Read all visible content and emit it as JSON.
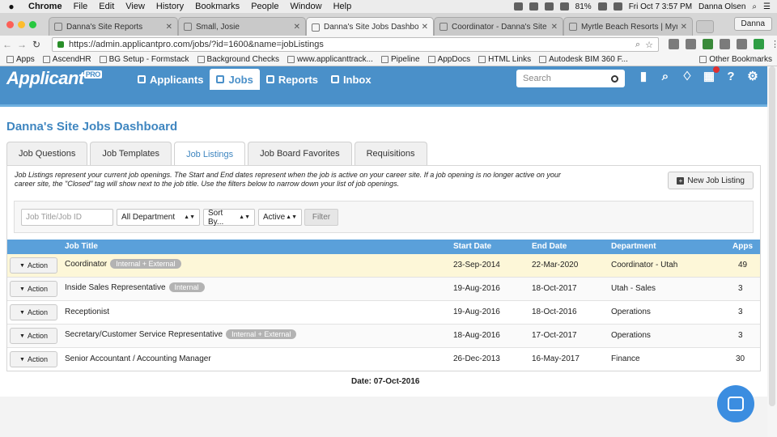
{
  "mac_menu": {
    "app": "Chrome",
    "items": [
      "File",
      "Edit",
      "View",
      "History",
      "Bookmarks",
      "People",
      "Window",
      "Help"
    ],
    "battery": "81%",
    "clock": "Fri Oct 7  3:57 PM",
    "user": "Danna Olsen"
  },
  "browser": {
    "tabs": [
      {
        "label": "Danna's Site Reports",
        "active": false
      },
      {
        "label": "Small, Josie",
        "active": false
      },
      {
        "label": "Danna's Site Jobs Dashboard",
        "active": true
      },
      {
        "label": "Coordinator - Danna's Site",
        "active": false
      },
      {
        "label": "Myrtle Beach Resorts | Myrtle",
        "active": false
      }
    ],
    "profile": "Danna",
    "url": "https://admin.applicantpro.com/jobs/?id=1600&name=jobListings",
    "bookmarks": [
      "Apps",
      "AscendHR",
      "BG Setup - Formstack",
      "Background Checks",
      "www.applicanttrack...",
      "Pipeline",
      "AppDocs",
      "HTML Links",
      "Autodesk BIM 360 F..."
    ],
    "other_bookmarks": "Other Bookmarks"
  },
  "header": {
    "logo": "Applicant",
    "logo_badge": "PRO",
    "nav": [
      {
        "label": "Applicants",
        "icon": "user-icon",
        "active": false
      },
      {
        "label": "Jobs",
        "icon": "document-icon",
        "active": true
      },
      {
        "label": "Reports",
        "icon": "bar-chart-icon",
        "active": false
      },
      {
        "label": "Inbox",
        "icon": "chat-icon",
        "active": false
      }
    ],
    "search_placeholder": "Search"
  },
  "page": {
    "title": "Danna's Site Jobs Dashboard",
    "tabs": [
      "Job Questions",
      "Job Templates",
      "Job Listings",
      "Job Board Favorites",
      "Requisitions"
    ],
    "active_tab": "Job Listings",
    "description": "Job Listings represent your current job openings. The Start and End dates represent when the job is active on your career site. If a job opening is no longer active on your career site, the \"Closed\" tag will show next to the job title. Use the filters below to narrow down your list of job openings.",
    "new_button": "New Job Listing",
    "filters": {
      "title_placeholder": "Job Title/Job ID",
      "department": "All Department",
      "sort": "Sort By...",
      "status": "Active",
      "button": "Filter"
    },
    "columns": [
      "Job Title",
      "Start Date",
      "End Date",
      "Department",
      "Apps"
    ],
    "action_label": "Action",
    "rows": [
      {
        "title": "Coordinator",
        "tag": "Internal + External",
        "start": "23-Sep-2014",
        "end": "22-Mar-2020",
        "dept": "Coordinator - Utah",
        "apps": "49"
      },
      {
        "title": "Inside Sales Representative",
        "tag": "Internal",
        "start": "19-Aug-2016",
        "end": "18-Oct-2017",
        "dept": "Utah - Sales",
        "apps": "3"
      },
      {
        "title": "Receptionist",
        "tag": "",
        "start": "19-Aug-2016",
        "end": "18-Oct-2016",
        "dept": "Operations",
        "apps": "3"
      },
      {
        "title": "Secretary/Customer Service Representative",
        "tag": "Internal + External",
        "start": "18-Aug-2016",
        "end": "17-Oct-2017",
        "dept": "Operations",
        "apps": "3"
      },
      {
        "title": "Senior Accountant / Accounting Manager",
        "tag": "",
        "start": "26-Dec-2013",
        "end": "16-May-2017",
        "dept": "Finance",
        "apps": "30"
      }
    ],
    "date_footer": "Date: 07-Oct-2016"
  },
  "colors": {
    "brand": "#4a90c9",
    "table_header": "#5aa0da",
    "highlight_row": "#fdf7d8"
  }
}
